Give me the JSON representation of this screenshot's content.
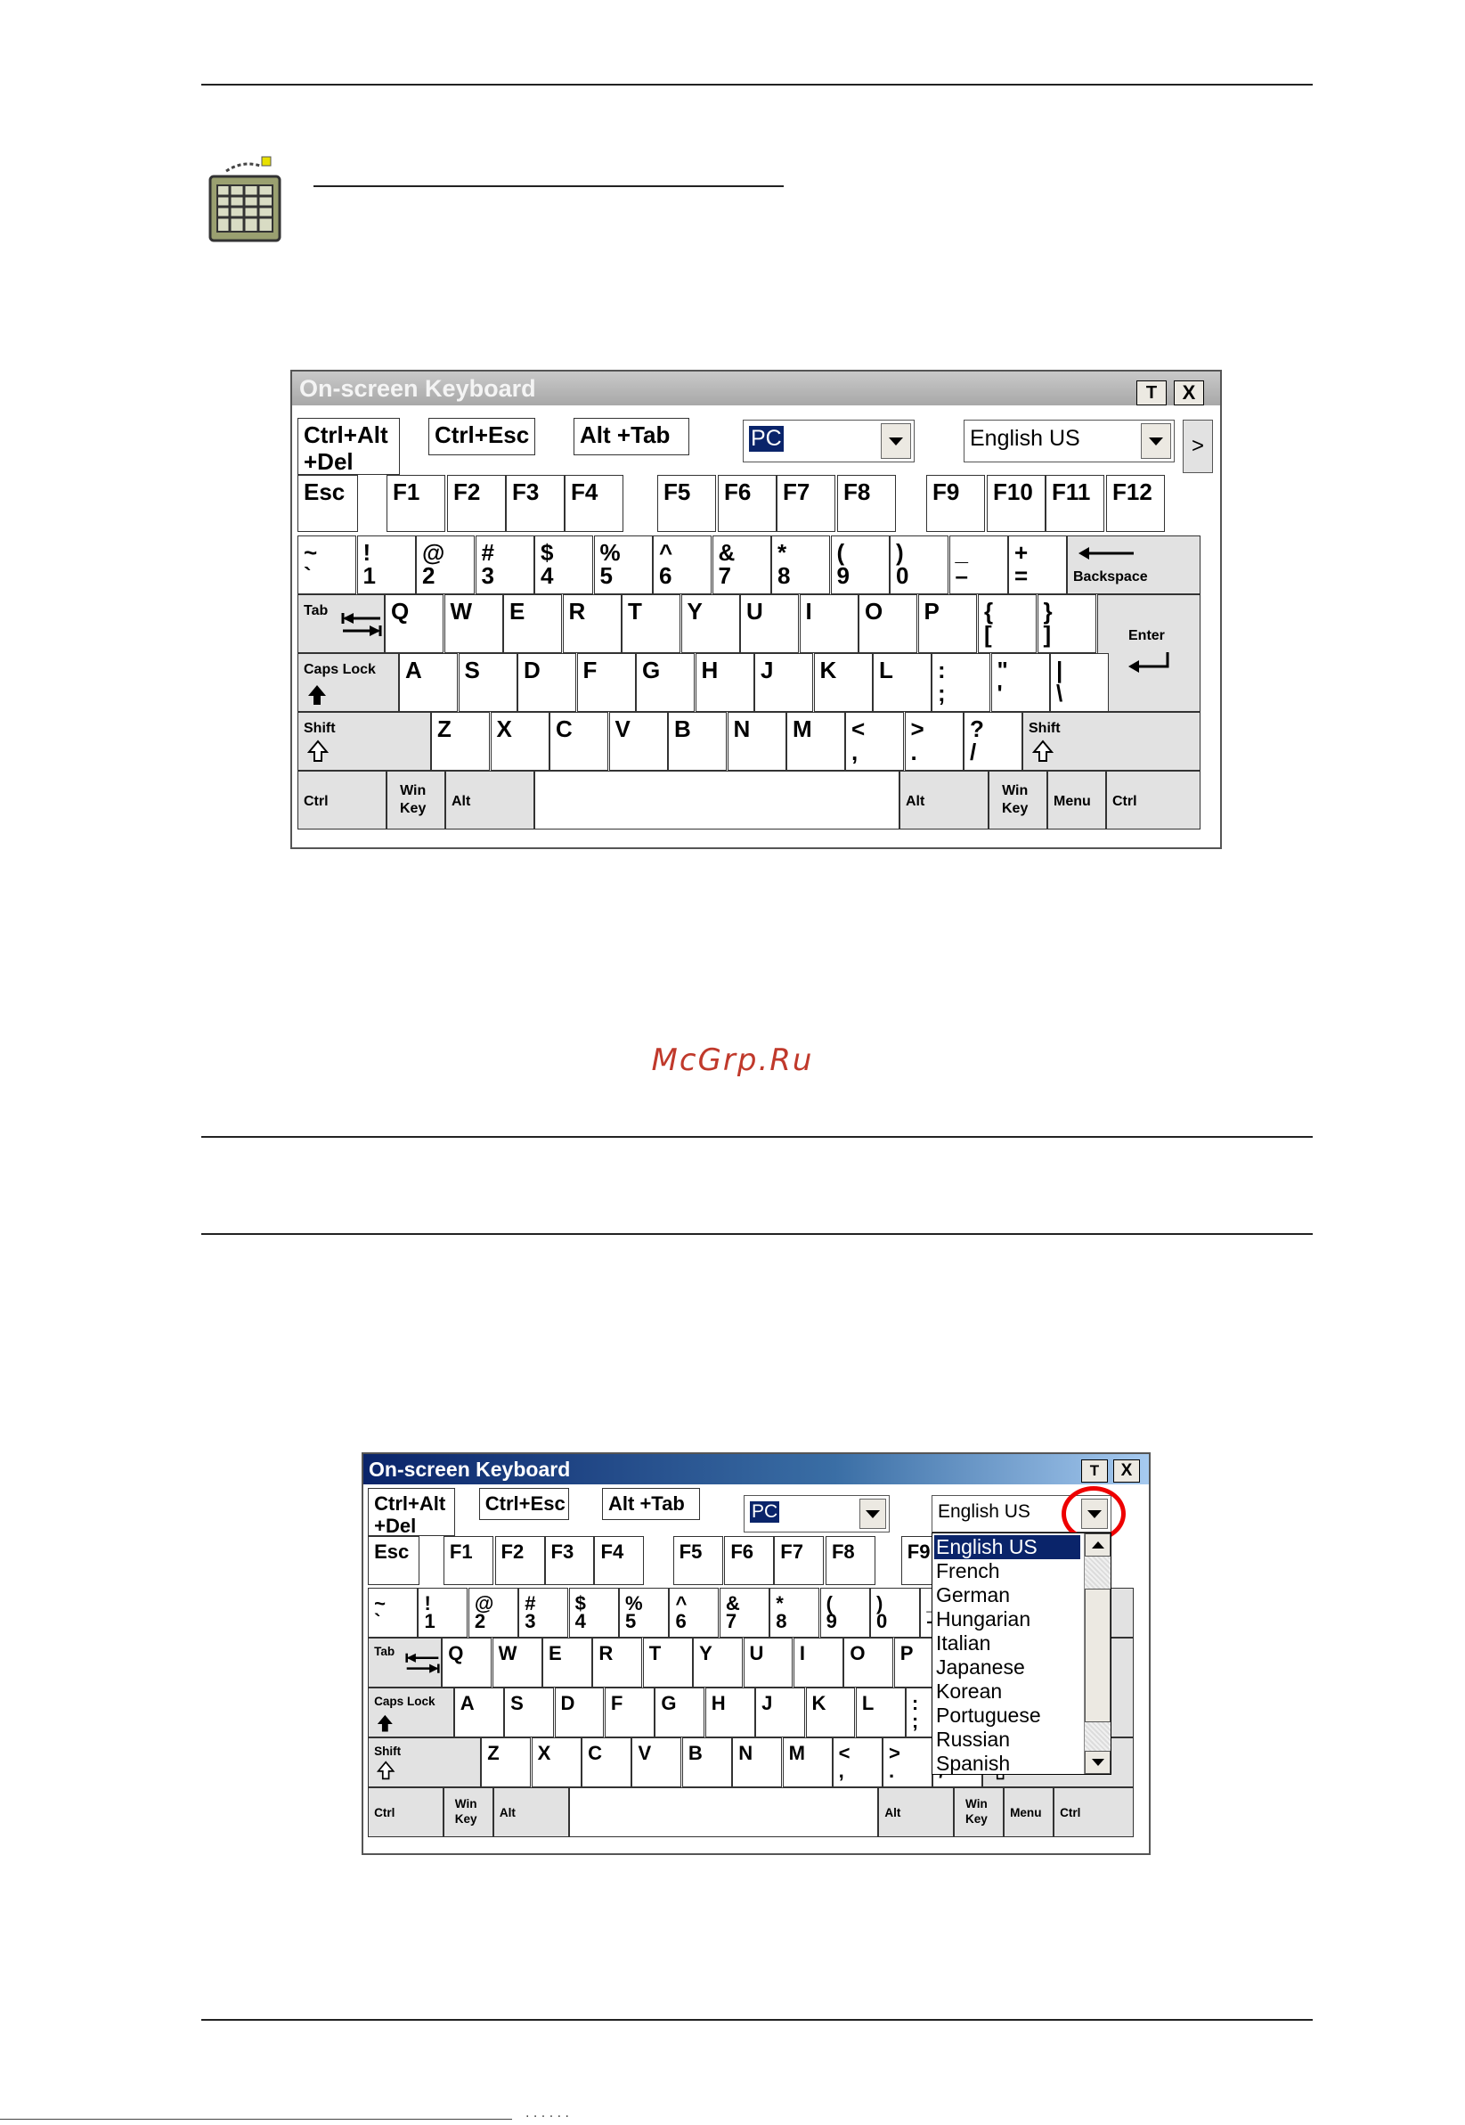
{
  "keyboard1": {
    "title": "On-screen Keyboard",
    "btn_top": "T",
    "btn_close": "X",
    "expand": ">",
    "mode": "PC",
    "language": "English US"
  },
  "keyboard2": {
    "title": "On-screen Keyboard",
    "btn_top": "T",
    "btn_close": "X",
    "expand": ">",
    "mode": "PC",
    "language": "English US",
    "language_options": [
      "English US",
      "French",
      "German",
      "Hungarian",
      "Italian",
      "Japanese",
      "Korean",
      "Portuguese",
      "Russian",
      "Spanish"
    ],
    "selected_option": "English US"
  },
  "keys": {
    "ctrl_alt_del": "Ctrl+Alt\n+Del",
    "ctrl_esc": "Ctrl+Esc",
    "alt_tab": "Alt +Tab",
    "esc": "Esc",
    "f1": "F1",
    "f2": "F2",
    "f3": "F3",
    "f4": "F4",
    "f5": "F5",
    "f6": "F6",
    "f7": "F7",
    "f8": "F8",
    "f9": "F9",
    "f10": "F10",
    "f11": "F11",
    "f12": "F12",
    "number_row": [
      [
        "~",
        "`"
      ],
      [
        "!",
        "1"
      ],
      [
        "@",
        "2"
      ],
      [
        "#",
        "3"
      ],
      [
        "$",
        "4"
      ],
      [
        "%",
        "5"
      ],
      [
        "^",
        "6"
      ],
      [
        "&",
        "7"
      ],
      [
        "*",
        "8"
      ],
      [
        "(",
        "9"
      ],
      [
        ")",
        "0"
      ],
      [
        "_",
        "–"
      ],
      [
        "+",
        "="
      ]
    ],
    "backspace": "Backspace",
    "tab": "Tab",
    "q_row": [
      "Q",
      "W",
      "E",
      "R",
      "T",
      "Y",
      "U",
      "I",
      "O",
      "P"
    ],
    "brackets": [
      [
        "{",
        "["
      ],
      [
        "}",
        "]"
      ]
    ],
    "enter": "Enter",
    "caps_lock": "Caps Lock",
    "a_row": [
      "A",
      "S",
      "D",
      "F",
      "G",
      "H",
      "J",
      "K",
      "L"
    ],
    "a_row_punct": [
      [
        ":",
        ";"
      ],
      [
        "\"",
        "'"
      ],
      [
        "|",
        "\\"
      ]
    ],
    "shift": "Shift",
    "z_row": [
      "Z",
      "X",
      "C",
      "V",
      "B",
      "N",
      "M"
    ],
    "z_row_punct": [
      [
        "<",
        ","
      ],
      [
        ">",
        "."
      ],
      [
        "?",
        "/"
      ]
    ],
    "ctrl": "Ctrl",
    "win_key": "Win\nKey",
    "alt": "Alt",
    "menu": "Menu"
  },
  "watermark": "McGrp.Ru",
  "footer_fragment": "· · ·   ·  · ·"
}
